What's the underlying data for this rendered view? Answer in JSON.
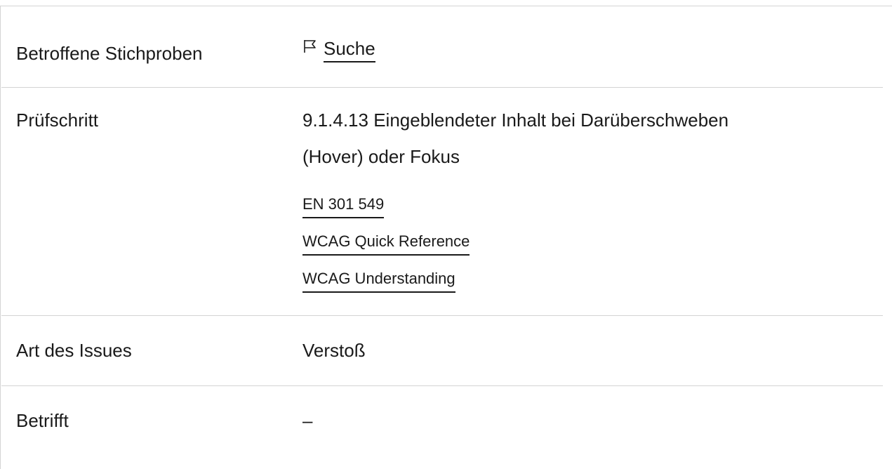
{
  "rows": [
    {
      "label": "Betroffene Stichproben",
      "link_label": "Suche",
      "icon": "flag-icon"
    },
    {
      "label": "Prüfschritt",
      "value_line1": "9.1.4.13 Eingeblendeter Inhalt bei Darüberschweben",
      "value_line2": "(Hover) oder Fokus",
      "links": [
        "EN 301 549",
        "WCAG Quick Reference",
        "WCAG Understanding"
      ]
    },
    {
      "label": "Art des Issues",
      "value": "Verstoß"
    },
    {
      "label": "Betrifft",
      "value": "–"
    }
  ]
}
